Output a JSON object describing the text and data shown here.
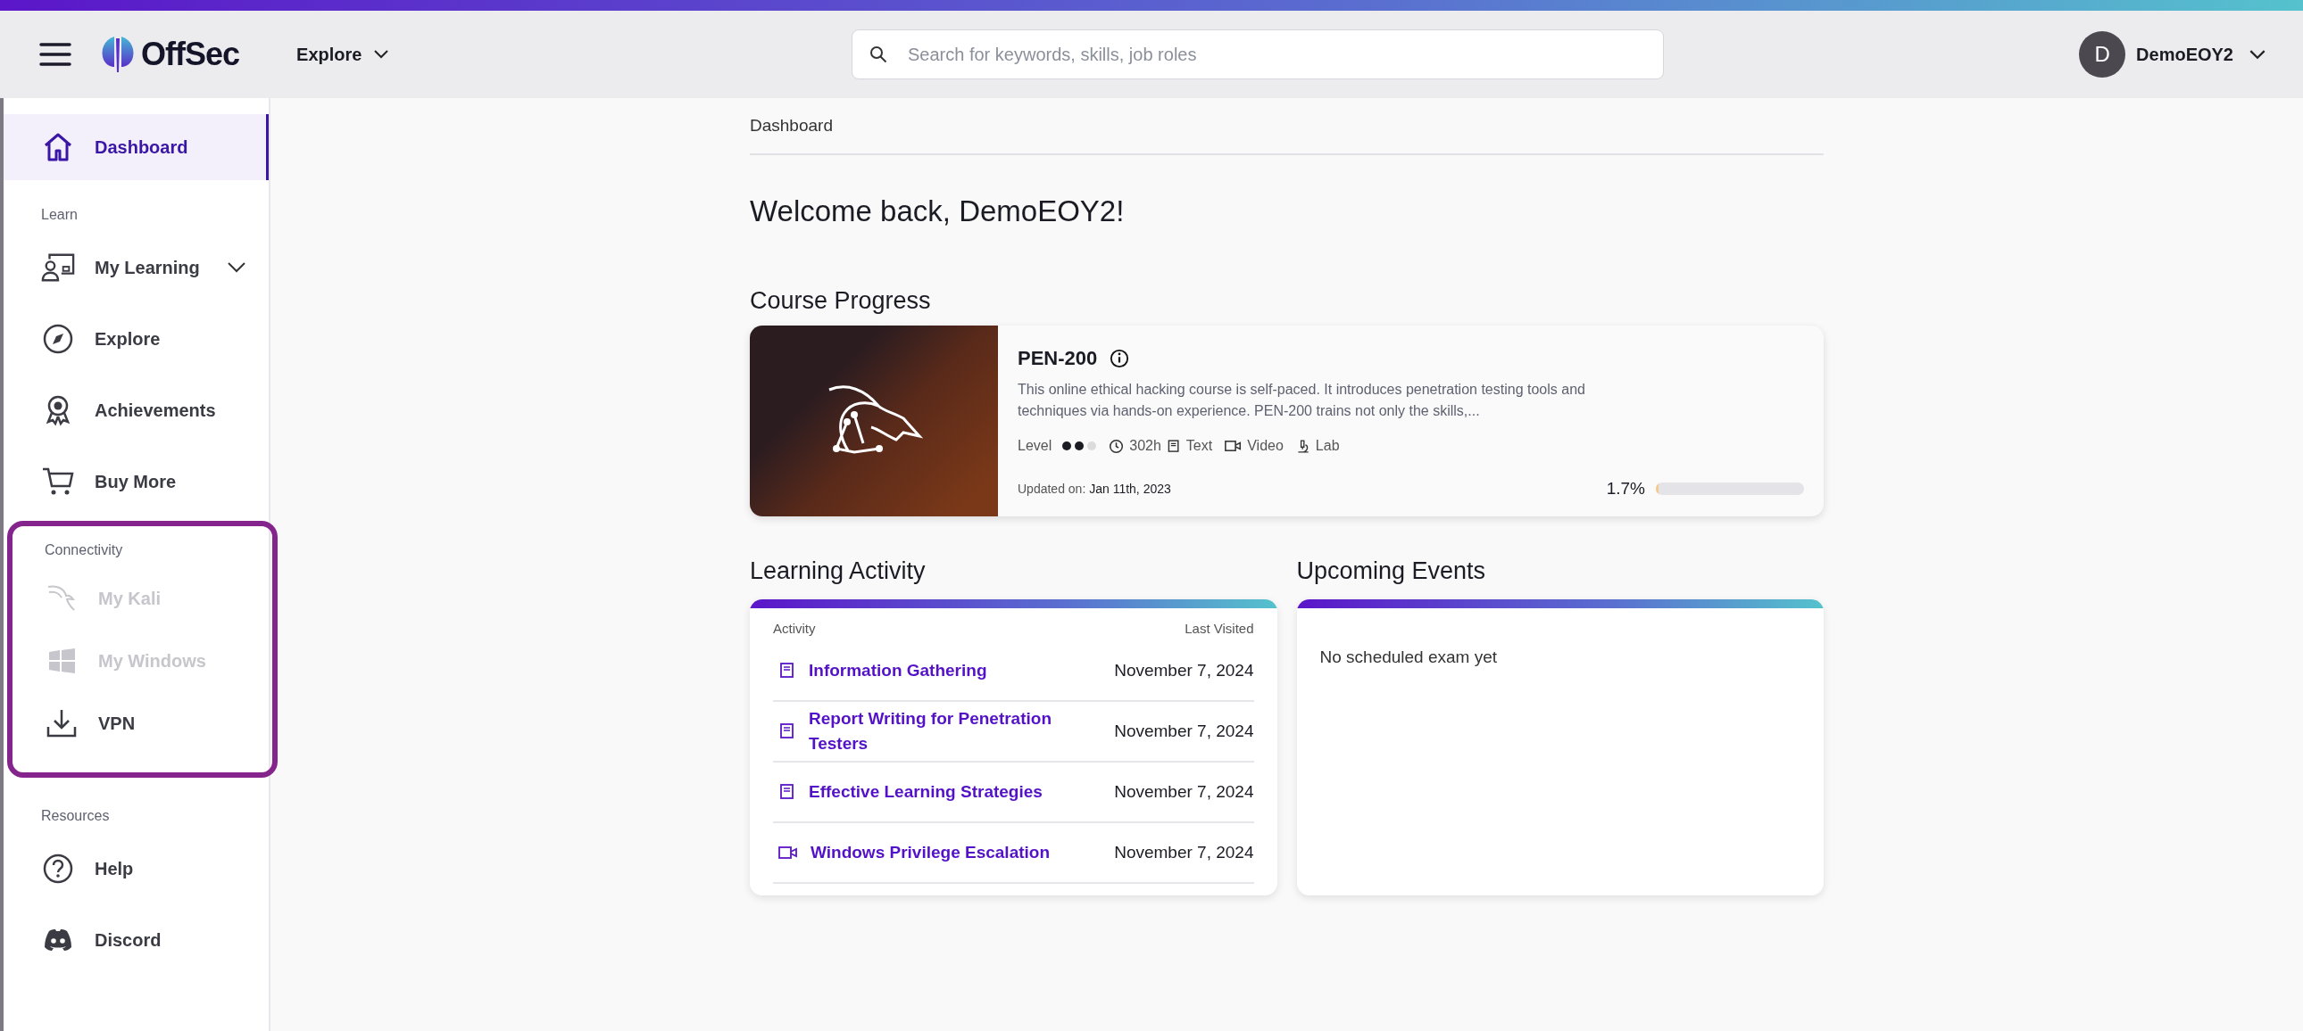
{
  "header": {
    "logo_text": "OffSec",
    "explore_menu": "Explore",
    "search": {
      "placeholder": "Search for keywords, skills, job roles"
    },
    "user": {
      "avatar_initial": "D",
      "name": "DemoEOY2"
    }
  },
  "sidebar": {
    "sections": [
      {
        "items": [
          {
            "label": "Dashboard",
            "selected": true,
            "disabled": false
          }
        ]
      },
      {
        "heading": "Learn",
        "items": [
          {
            "label": "My Learning",
            "selected": false,
            "disabled": false,
            "expandable": true
          },
          {
            "label": "Explore",
            "selected": false,
            "disabled": false
          },
          {
            "label": "Achievements",
            "selected": false,
            "disabled": false
          },
          {
            "label": "Buy More",
            "selected": false,
            "disabled": false
          }
        ]
      },
      {
        "heading": "Connectivity",
        "highlighted": true,
        "items": [
          {
            "label": "My Kali",
            "selected": false,
            "disabled": true
          },
          {
            "label": "My Windows",
            "selected": false,
            "disabled": true
          },
          {
            "label": "VPN",
            "selected": false,
            "disabled": false
          }
        ]
      },
      {
        "heading": "Resources",
        "items": [
          {
            "label": "Help",
            "selected": false,
            "disabled": false
          },
          {
            "label": "Discord",
            "selected": false,
            "disabled": false
          }
        ]
      }
    ]
  },
  "breadcrumb": "Dashboard",
  "welcome": "Welcome back, DemoEOY2!",
  "course_progress": {
    "title": "Course Progress",
    "course": {
      "name": "PEN-200",
      "description": "This online ethical hacking course is self-paced. It introduces penetration testing tools and techniques via hands-on experience. PEN-200 trains not only the skills,...",
      "level_label": "Level",
      "level": 0.667,
      "duration": "302h",
      "formats": [
        {
          "kind": "text",
          "label": "Text"
        },
        {
          "kind": "video",
          "label": "Video"
        },
        {
          "kind": "lab",
          "label": "Lab"
        }
      ],
      "updated_label": "Updated on:",
      "updated_date": "Jan 11th, 2023",
      "progress_text": "1.7%",
      "progress": {
        "level": 0.017
      }
    }
  },
  "learning_activity": {
    "title": "Learning Activity",
    "columns": [
      "Activity",
      "Last Visited"
    ],
    "rows": [
      {
        "kind": "text",
        "title": "Information Gathering",
        "date": "November 7, 2024"
      },
      {
        "kind": "text",
        "title": "Report Writing for Penetration Testers",
        "date": "November 7, 2024"
      },
      {
        "kind": "text",
        "title": "Effective Learning Strategies",
        "date": "November 7, 2024"
      },
      {
        "kind": "video",
        "title": "Windows Privilege Escalation",
        "date": "November 7, 2024"
      }
    ]
  },
  "upcoming_events": {
    "title": "Upcoming Events",
    "message": "No scheduled exam yet"
  }
}
